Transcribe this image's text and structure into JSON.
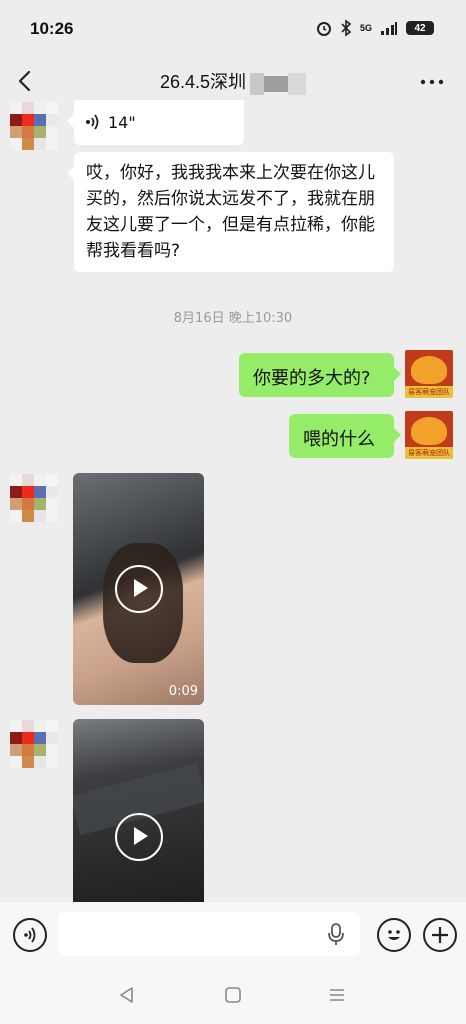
{
  "status": {
    "time": "10:26",
    "network": "5G",
    "battery": "42"
  },
  "header": {
    "title": "26.4.5深圳"
  },
  "messages": {
    "voice_duration": "14\"",
    "incoming_text": "哎，你好，我我我本来上次要在你这儿买的，然后你说太远发不了，我就在朋友这儿要了一个，但是有点拉稀，你能帮我看看吗?",
    "timestamp": "8月16日 晚上10:30",
    "out1": "你要的多大的?",
    "out2": "喂的什么",
    "video1_duration": "0:09",
    "my_avatar_caption": "易客萌宠团队"
  },
  "colors": {
    "bubble_out": "#95ec69",
    "background": "#ededed"
  },
  "icons": [
    "back-arrow-icon",
    "more-icon",
    "voice-icon",
    "play-icon",
    "mic-icon",
    "emoji-icon",
    "plus-icon",
    "nav-back-icon",
    "nav-home-icon",
    "nav-menu-icon"
  ]
}
